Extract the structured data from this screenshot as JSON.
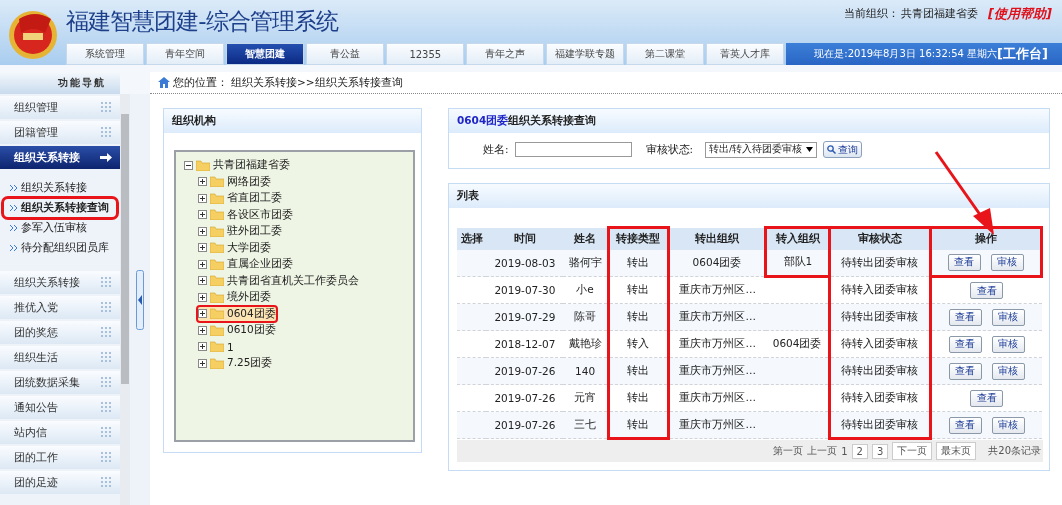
{
  "header": {
    "title": "福建智慧团建-综合管理系统",
    "org_label": "当前组织：",
    "org_name": "共青团福建省委",
    "help_link": "[使用帮助]",
    "datetime": "现在是:2019年8月3日  16:32:54  星期六",
    "workbench": "[工作台]"
  },
  "tabs": [
    {
      "label": "系统管理",
      "selected": false
    },
    {
      "label": "青年空间",
      "selected": false
    },
    {
      "label": "智慧团建",
      "selected": true
    },
    {
      "label": "青公益",
      "selected": false
    },
    {
      "label": "12355",
      "selected": false
    },
    {
      "label": "青年之声",
      "selected": false
    },
    {
      "label": "福建学联专题",
      "selected": false
    },
    {
      "label": "第二课堂",
      "selected": false
    },
    {
      "label": "菁英人才库",
      "selected": false
    }
  ],
  "breadcrumb": {
    "label": "您的位置：",
    "path": "组织关系转接>>组织关系转接查询"
  },
  "sidebar": {
    "title": "功能导航",
    "items": [
      {
        "label": "组织管理",
        "expanded": false
      },
      {
        "label": "团籍管理",
        "expanded": false
      },
      {
        "label": "组织关系转接",
        "expanded": true,
        "children": [
          {
            "label": "组织关系转接",
            "selected": false,
            "highlighted": false
          },
          {
            "label": "组织关系转接查询",
            "selected": true,
            "highlighted": true
          },
          {
            "label": "参军入伍审核",
            "selected": false,
            "highlighted": false
          },
          {
            "label": "待分配组织团员库",
            "selected": false,
            "highlighted": false
          }
        ]
      },
      {
        "label": "组织关系转接",
        "expanded": false
      },
      {
        "label": "推优入党",
        "expanded": false
      },
      {
        "label": "团的奖惩",
        "expanded": false
      },
      {
        "label": "组织生活",
        "expanded": false
      },
      {
        "label": "团统数据采集",
        "expanded": false
      },
      {
        "label": "通知公告",
        "expanded": false
      },
      {
        "label": "站内信",
        "expanded": false
      },
      {
        "label": "团的工作",
        "expanded": false
      },
      {
        "label": "团的足迹",
        "expanded": false
      }
    ]
  },
  "org_panel": {
    "title": "组织机构",
    "tree": [
      {
        "label": "共青团福建省委",
        "expanded": true,
        "selected": false,
        "highlighted": false,
        "children": [
          {
            "label": "网络团委",
            "expanded": false,
            "selected": false,
            "highlighted": false
          },
          {
            "label": "省直团工委",
            "expanded": false,
            "selected": false,
            "highlighted": false
          },
          {
            "label": "各设区市团委",
            "expanded": false,
            "selected": false,
            "highlighted": false
          },
          {
            "label": "驻外团工委",
            "expanded": false,
            "selected": false,
            "highlighted": false
          },
          {
            "label": "大学团委",
            "expanded": false,
            "selected": false,
            "highlighted": false
          },
          {
            "label": "直属企业团委",
            "expanded": false,
            "selected": false,
            "highlighted": false
          },
          {
            "label": "共青团省直机关工作委员会",
            "expanded": false,
            "selected": false,
            "highlighted": false
          },
          {
            "label": "境外团委",
            "expanded": false,
            "selected": false,
            "highlighted": false
          },
          {
            "label": "0604团委",
            "expanded": false,
            "selected": true,
            "highlighted": true
          },
          {
            "label": "0610团委",
            "expanded": false,
            "selected": false,
            "highlighted": false
          },
          {
            "label": "1",
            "expanded": false,
            "selected": false,
            "highlighted": false
          },
          {
            "label": "7.25团委",
            "expanded": false,
            "selected": false,
            "highlighted": false
          }
        ]
      }
    ]
  },
  "query_panel": {
    "org": "0604团委",
    "title": "组织关系转接查询",
    "name_label": "姓名:",
    "status_label": "审核状态:",
    "status_value": "转出/转入待团委审核",
    "search_button": "查询"
  },
  "list_panel": {
    "title": "列表",
    "columns": [
      {
        "label": "选择",
        "highlighted": false
      },
      {
        "label": "时间",
        "highlighted": false
      },
      {
        "label": "姓名",
        "highlighted": false
      },
      {
        "label": "转接类型",
        "highlighted": true,
        "box_full_height": true
      },
      {
        "label": "转出组织",
        "highlighted": false
      },
      {
        "label": "转入组织",
        "highlighted": true,
        "box_full_height": false
      },
      {
        "label": "审核状态",
        "highlighted": true,
        "box_full_height": true
      },
      {
        "label": "操作",
        "highlighted": true,
        "box_full_height": false
      }
    ],
    "rows": [
      {
        "cells": [
          "",
          "2019-08-03",
          "骆何宇",
          "转出",
          "0604团委",
          "部队1",
          "待转出团委审核"
        ],
        "actions": [
          "查看",
          "审核"
        ]
      },
      {
        "cells": [
          "",
          "2019-07-30",
          "小e",
          "转出",
          "重庆市万州区…",
          "",
          "待转入团委审核"
        ],
        "actions": [
          "查看"
        ]
      },
      {
        "cells": [
          "",
          "2019-07-29",
          "陈哥",
          "转出",
          "重庆市万州区…",
          "",
          "待转出团委审核"
        ],
        "actions": [
          "查看",
          "审核"
        ]
      },
      {
        "cells": [
          "",
          "2018-12-07",
          "戴艳珍",
          "转入",
          "重庆市万州区…",
          "0604团委",
          "待转入团委审核"
        ],
        "actions": [
          "查看",
          "审核"
        ]
      },
      {
        "cells": [
          "",
          "2019-07-26",
          "140",
          "转出",
          "重庆市万州区…",
          "",
          "待转出团委审核"
        ],
        "actions": [
          "查看",
          "审核"
        ]
      },
      {
        "cells": [
          "",
          "2019-07-26",
          "元宵",
          "转出",
          "重庆市万州区…",
          "",
          "待转入团委审核"
        ],
        "actions": [
          "查看"
        ]
      },
      {
        "cells": [
          "",
          "2019-07-26",
          "三七",
          "转出",
          "重庆市万州区…",
          "",
          "待转出团委审核"
        ],
        "actions": [
          "查看",
          "审核"
        ]
      }
    ],
    "pagination": {
      "first": "第一页",
      "prev": "上一页",
      "pages": [
        {
          "label": "1",
          "selected": true
        },
        {
          "label": "2",
          "selected": false
        },
        {
          "label": "3",
          "selected": false
        }
      ],
      "next": "下一页",
      "last": "最末页",
      "total": "共20条记录"
    }
  },
  "annotation_arrow": true
}
